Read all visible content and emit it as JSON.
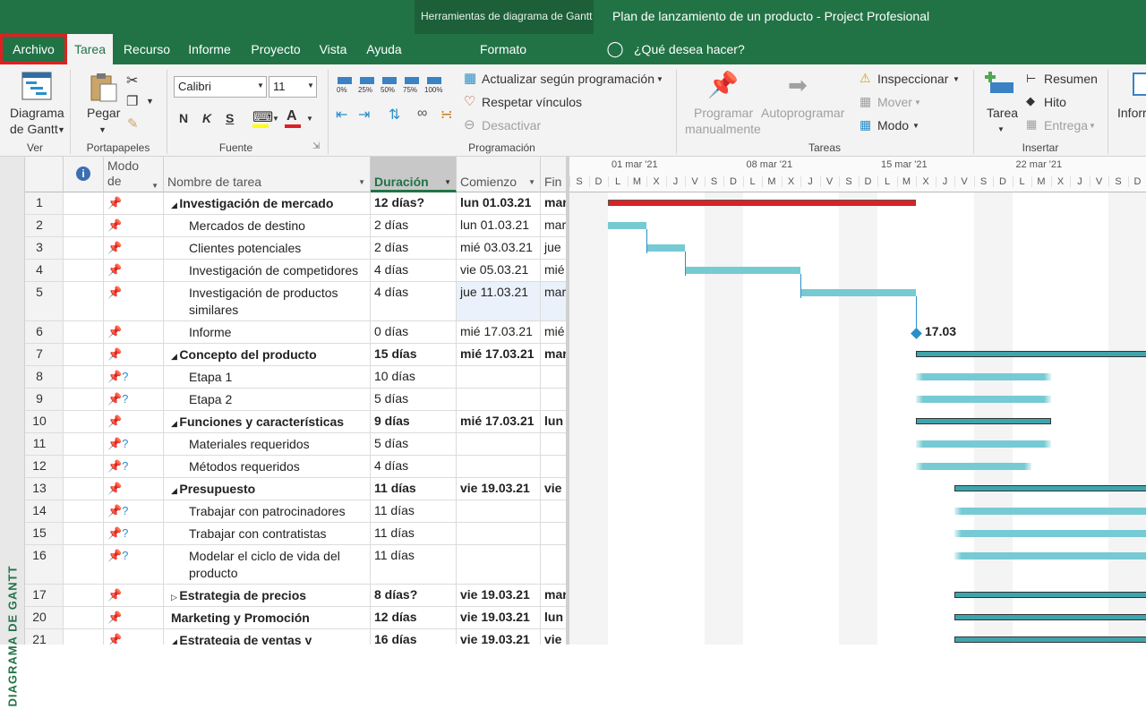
{
  "titlebar": {
    "context_tab_group": "Herramientas de diagrama de Gantt",
    "window_title": "Plan de lanzamiento de un producto  -  Project Profesional"
  },
  "tabs": [
    "Archivo",
    "Tarea",
    "Recurso",
    "Informe",
    "Proyecto",
    "Vista",
    "Ayuda",
    "Formato"
  ],
  "search_placeholder": "¿Qué desea hacer?",
  "ribbon": {
    "gantt_btn": [
      "Diagrama",
      "de Gantt"
    ],
    "paste": "Pegar",
    "font_name": "Calibri",
    "font_size": "11",
    "bold": "N",
    "italic": "K",
    "underline": "S",
    "update_schedule": "Actualizar según programación",
    "respect_links": "Respetar vínculos",
    "deactivate": "Desactivar",
    "pct": [
      "0%",
      "25%",
      "50%",
      "75%",
      "100%"
    ],
    "manual": [
      "Programar",
      "manualmente"
    ],
    "auto": "Autoprogramar",
    "inspect": "Inspeccionar",
    "move": "Mover",
    "mode": "Modo",
    "task": "Tarea",
    "summary": "Resumen",
    "milestone": "Hito",
    "deliverable": "Entrega",
    "info": "Inforr",
    "groups": [
      "Ver",
      "Portapapeles",
      "Fuente",
      "Programación",
      "Tareas",
      "Insertar"
    ]
  },
  "sidebar_label": "DIAGRAMA DE GANTT",
  "table": {
    "headers": {
      "mode": [
        "Modo",
        "de"
      ],
      "name": "Nombre de tarea",
      "duration": "Duración",
      "start": "Comienzo",
      "end": "Fin"
    },
    "rows": [
      {
        "id": "1",
        "name": "Investigación de mercado",
        "dur": "12 días?",
        "start": "lun 01.03.21",
        "end": "mar",
        "summary": true
      },
      {
        "id": "2",
        "name": "Mercados de destino",
        "dur": "2 días",
        "start": "lun 01.03.21",
        "end": "mar"
      },
      {
        "id": "3",
        "name": "Clientes potenciales",
        "dur": "2 días",
        "start": "mié 03.03.21",
        "end": "jue"
      },
      {
        "id": "4",
        "name": "Investigación de competidores",
        "dur": "4 días",
        "start": "vie 05.03.21",
        "end": "mié"
      },
      {
        "id": "5",
        "name": "Investigación de productos similares",
        "dur": "4 días",
        "start": "jue 11.03.21",
        "end": "mar"
      },
      {
        "id": "6",
        "name": "Informe",
        "dur": "0 días",
        "start": "mié 17.03.21",
        "end": "mié"
      },
      {
        "id": "7",
        "name": "Concepto del producto",
        "dur": "15 días",
        "start": "mié 17.03.21",
        "end": "mar",
        "summary": true
      },
      {
        "id": "8",
        "name": "Etapa 1",
        "dur": "10 días",
        "start": "",
        "end": ""
      },
      {
        "id": "9",
        "name": "Etapa 2",
        "dur": "5 días",
        "start": "",
        "end": ""
      },
      {
        "id": "10",
        "name": "Funciones y características",
        "dur": "9 días",
        "start": "mié 17.03.21",
        "end": "lun",
        "summary": true
      },
      {
        "id": "11",
        "name": "Materiales requeridos",
        "dur": "5 días",
        "start": "",
        "end": ""
      },
      {
        "id": "12",
        "name": "Métodos requeridos",
        "dur": "4 días",
        "start": "",
        "end": ""
      },
      {
        "id": "13",
        "name": "Presupuesto",
        "dur": "11 días",
        "start": "vie 19.03.21",
        "end": "vie",
        "summary": true
      },
      {
        "id": "14",
        "name": "Trabajar con patrocinadores",
        "dur": "11 días",
        "start": "",
        "end": ""
      },
      {
        "id": "15",
        "name": "Trabajar con contratistas",
        "dur": "11 días",
        "start": "",
        "end": ""
      },
      {
        "id": "16",
        "name": "Modelar el ciclo de vida del producto",
        "dur": "11 días",
        "start": "",
        "end": ""
      },
      {
        "id": "17",
        "name": "Estrategia de precios",
        "dur": "8 días?",
        "start": "vie 19.03.21",
        "end": "mar",
        "summary": true
      },
      {
        "id": "20",
        "name": "Marketing y Promoción",
        "dur": "12 días",
        "start": "vie 19.03.21",
        "end": "lun",
        "summary": true
      },
      {
        "id": "21",
        "name": "Estrategia de ventas y",
        "dur": "16 días",
        "start": "vie 19.03.21",
        "end": "vie",
        "summary": true
      }
    ]
  },
  "gantt": {
    "weeks": [
      "01 mar '21",
      "08 mar '21",
      "15 mar '21",
      "22 mar '21"
    ],
    "days": [
      "S",
      "D",
      "L",
      "M",
      "X",
      "J",
      "V",
      "S",
      "D",
      "L",
      "M",
      "X",
      "J",
      "V",
      "S",
      "D",
      "L",
      "M",
      "X",
      "J",
      "V",
      "S",
      "D",
      "L",
      "M",
      "X",
      "J",
      "V",
      "S",
      "D"
    ],
    "milestone_label": "17.03"
  }
}
